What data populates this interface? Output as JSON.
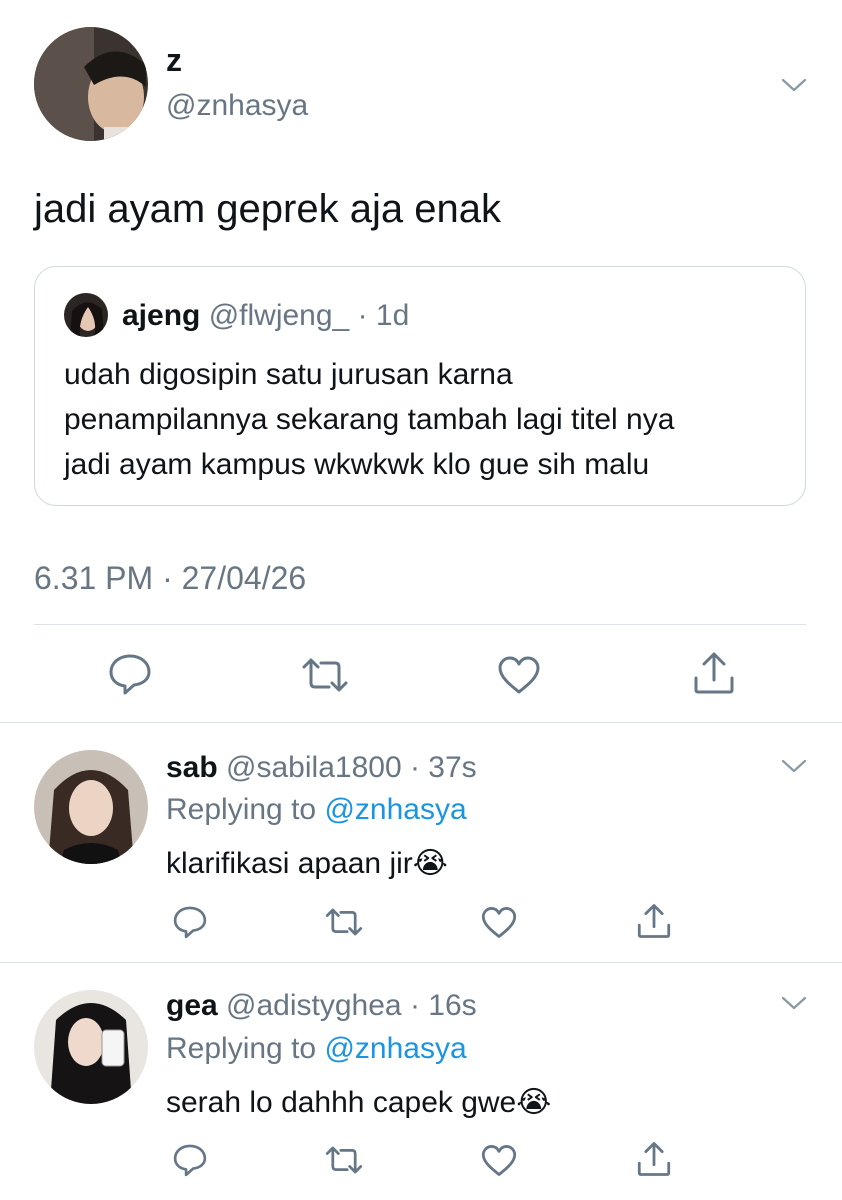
{
  "main_tweet": {
    "display_name": "z",
    "handle": "@znhasya",
    "text": "jadi ayam geprek aja enak",
    "timestamp": "6.31 PM · 27/04/26"
  },
  "quoted_tweet": {
    "display_name": "ajeng",
    "handle": "@flwjeng_",
    "time": "· 1d",
    "lines": [
      "udah digosipin satu jurusan karna",
      "penampilannya sekarang tambah lagi titel nya",
      "jadi ayam kampus wkwkwk klo gue sih malu"
    ]
  },
  "replies": [
    {
      "display_name": "sab",
      "handle": "@sabila1800",
      "time": "· 37s",
      "replying_prefix": "Replying to",
      "replying_to": "@znhasya",
      "text": "klarifikasi apaan jir",
      "emoji": "😭"
    },
    {
      "display_name": "gea",
      "handle": "@adistyghea",
      "time": "· 16s",
      "replying_prefix": "Replying to",
      "replying_to": "@znhasya",
      "text": "serah lo dahhh capek gwe",
      "emoji": "😭"
    }
  ],
  "action_icons": [
    "reply-icon",
    "retweet-icon",
    "like-icon",
    "share-icon"
  ],
  "colors": {
    "text": "#0f1419",
    "secondary": "#687684",
    "link": "#1b95e0",
    "divider": "#dde2e6"
  }
}
